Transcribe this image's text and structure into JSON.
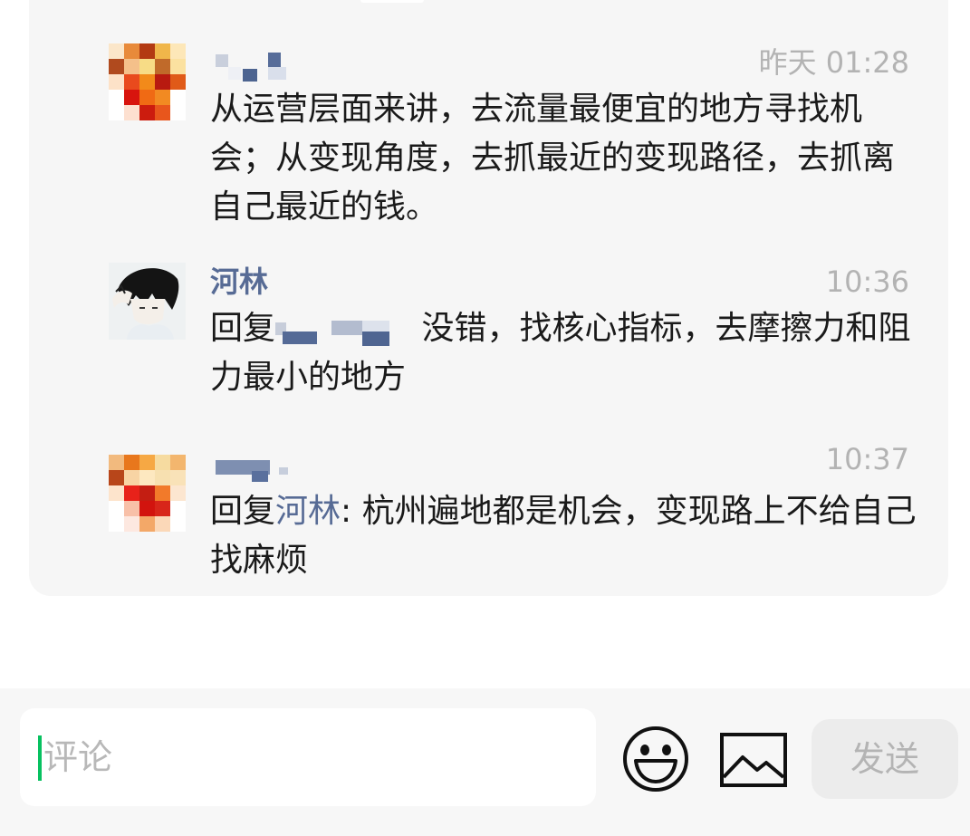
{
  "comments": [
    {
      "name": "",
      "time": "昨天 01:28",
      "text": "从运营层面来讲，去流量最便宜的地方寻找机会；从变现角度，去抓最近的变现路径，去抓离自己最近的钱。"
    },
    {
      "name": "河林",
      "time": "10:36",
      "reply_prefix": "回复",
      "text": "没错，找核心指标，去摩擦力和阻力最小的地方"
    },
    {
      "name": "",
      "time": "10:37",
      "reply_prefix": "回复",
      "reply_to": "河林",
      "text": ": 杭州遍地都是机会，变现路上不给自己找麻烦"
    }
  ],
  "composer": {
    "placeholder": "评论",
    "send_label": "发送"
  },
  "icons": {
    "emoji": "smiley-face-icon",
    "image": "image-picture-icon"
  },
  "colors": {
    "link": "#576b95",
    "caret": "#07c160",
    "timestamp": "#b3b3b3"
  }
}
